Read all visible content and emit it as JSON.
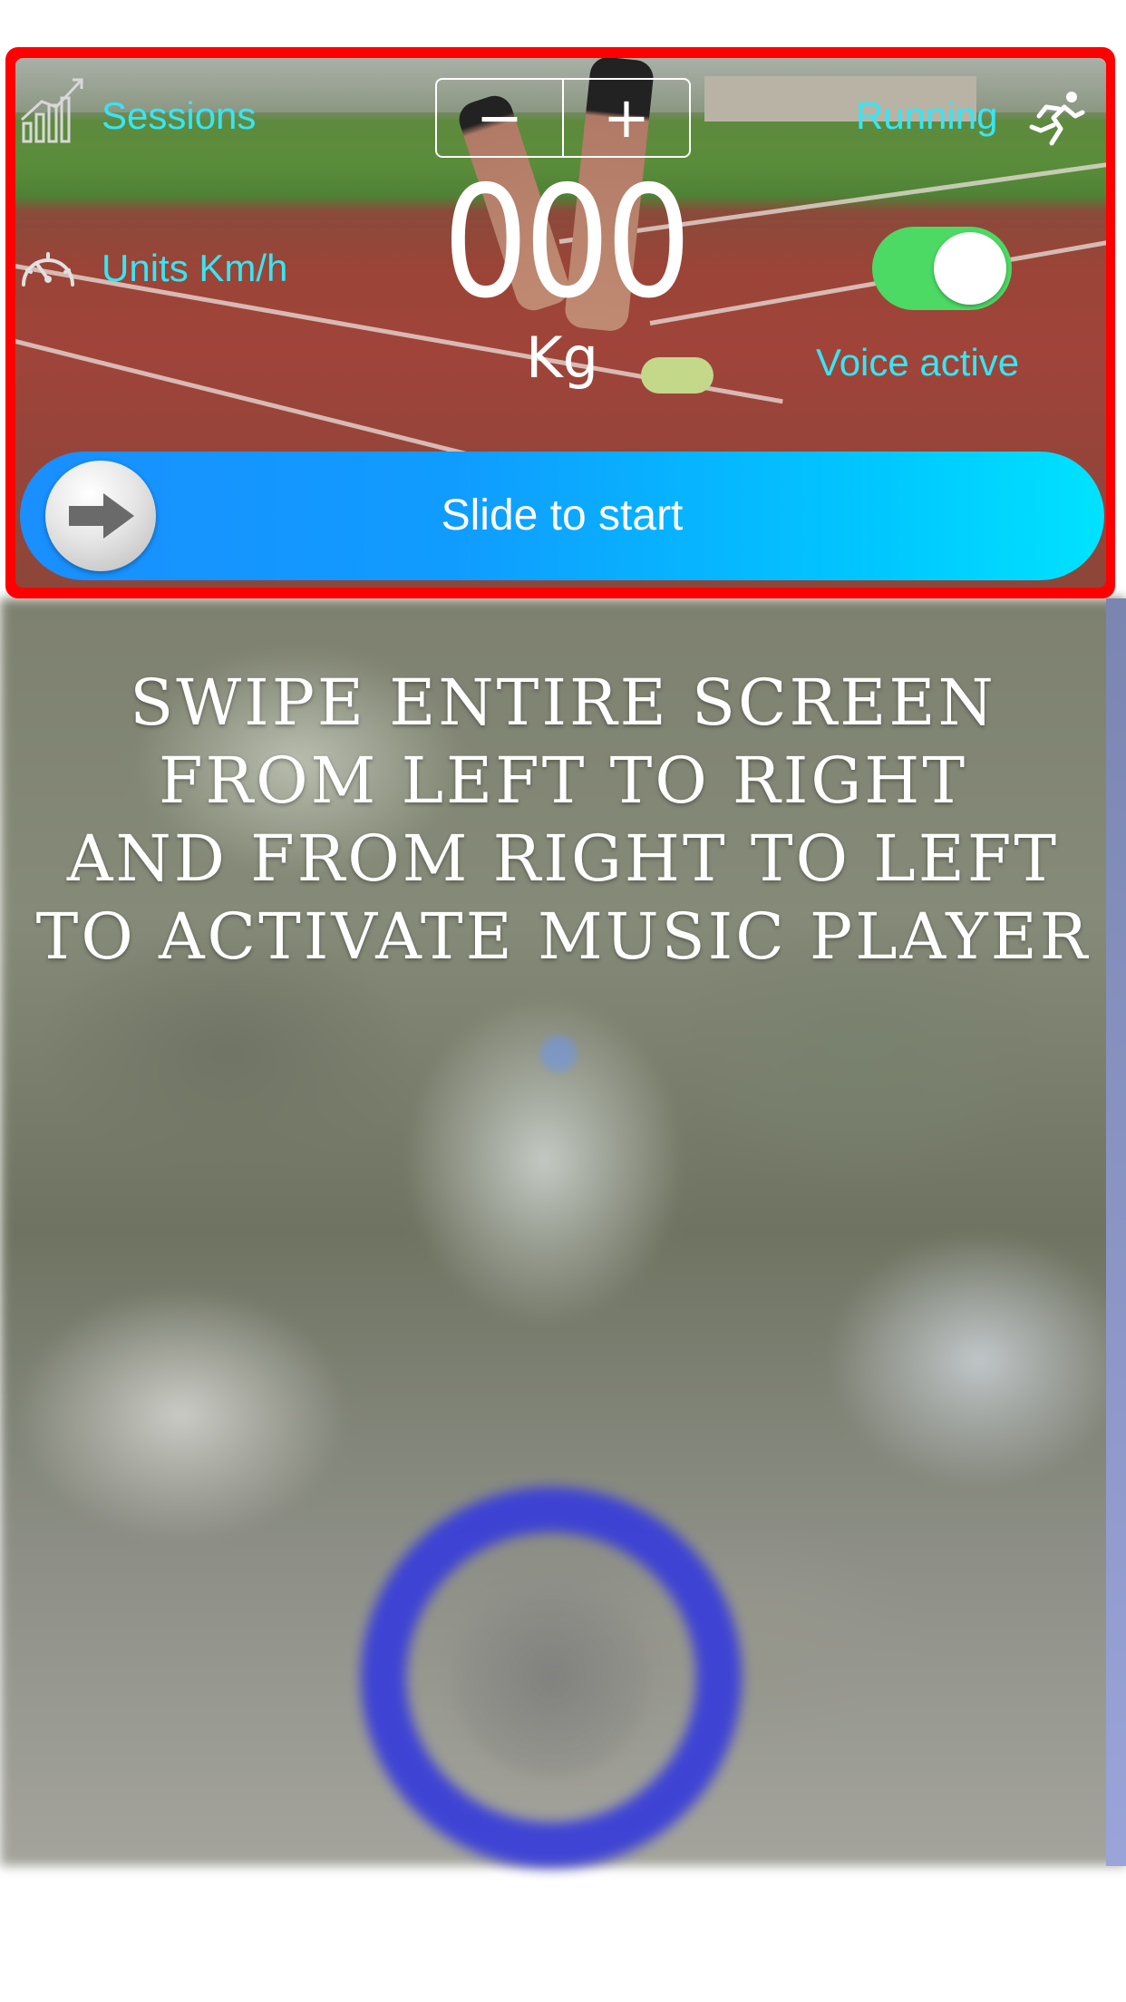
{
  "header": {
    "sessions_label": "Sessions",
    "units_label": "Units Km/h",
    "activity_label": "Running",
    "voice_label": "Voice active",
    "voice_active": true
  },
  "weight": {
    "value": "000",
    "unit": "Kg",
    "decrement_symbol": "−",
    "increment_symbol": "+"
  },
  "slider": {
    "label": "Slide to start"
  },
  "instructions": {
    "lines": [
      "SWIPE ENTIRE SCREEN",
      "FROM LEFT TO RIGHT",
      "AND FROM RIGHT TO LEFT",
      "TO ACTIVATE MUSIC PLAYER"
    ]
  },
  "icons": {
    "sessions": "bar-chart-trend-icon",
    "units": "speedometer-icon",
    "activity": "running-person-icon",
    "slider_knob": "arrow-right-icon"
  },
  "colors": {
    "accent_cyan": "#36e6f4",
    "toggle_on": "#4cd964",
    "highlight_frame": "#ff0000",
    "slider_start": "#1a8fff",
    "slider_end": "#00e2ff",
    "music_ring": "#3a3fd8"
  }
}
